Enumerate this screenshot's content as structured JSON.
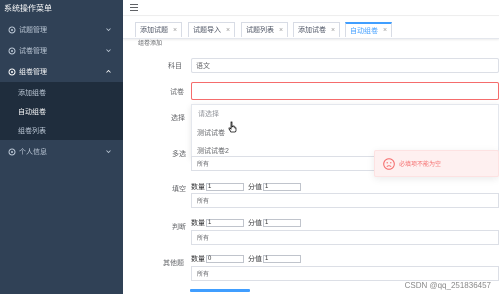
{
  "sidebar": {
    "title": "系统操作菜单",
    "items": [
      {
        "label": "试题管理"
      },
      {
        "label": "试卷管理"
      },
      {
        "label": "组卷管理"
      },
      {
        "label": "个人信息"
      }
    ],
    "subitems": [
      {
        "label": "添加组卷"
      },
      {
        "label": "自动组卷"
      },
      {
        "label": "组卷列表"
      }
    ]
  },
  "tabs": [
    {
      "label": "添加试题"
    },
    {
      "label": "试题导入"
    },
    {
      "label": "试题列表"
    },
    {
      "label": "添加试卷"
    },
    {
      "label": "自动组卷"
    }
  ],
  "breadcrumb": "组卷添加",
  "form": {
    "subject_label": "科目",
    "subject_value": "语文",
    "paper_label": "试卷",
    "paper_value": "",
    "choice_label": "选择",
    "multi_label": "多选",
    "fill_label": "填空",
    "judge_label": "判断",
    "other_label": "其他题",
    "dropdown_placeholder": "请选择",
    "dropdown_options": [
      "测试试卷",
      "测试试卷2"
    ],
    "all_text": "所有",
    "count_label": "数量",
    "score_label": "分值",
    "fill_count": "1",
    "fill_score": "1",
    "judge_count": "1",
    "judge_score": "1",
    "other_count": "0",
    "other_score": "1"
  },
  "toast": {
    "message": "必填项不能为空",
    "color": "#f56c6c"
  },
  "watermark": "CSDN @qq_251836457",
  "colors": {
    "sidebar_bg": "#304156",
    "accent": "#409eff",
    "error": "#f56c6c"
  }
}
